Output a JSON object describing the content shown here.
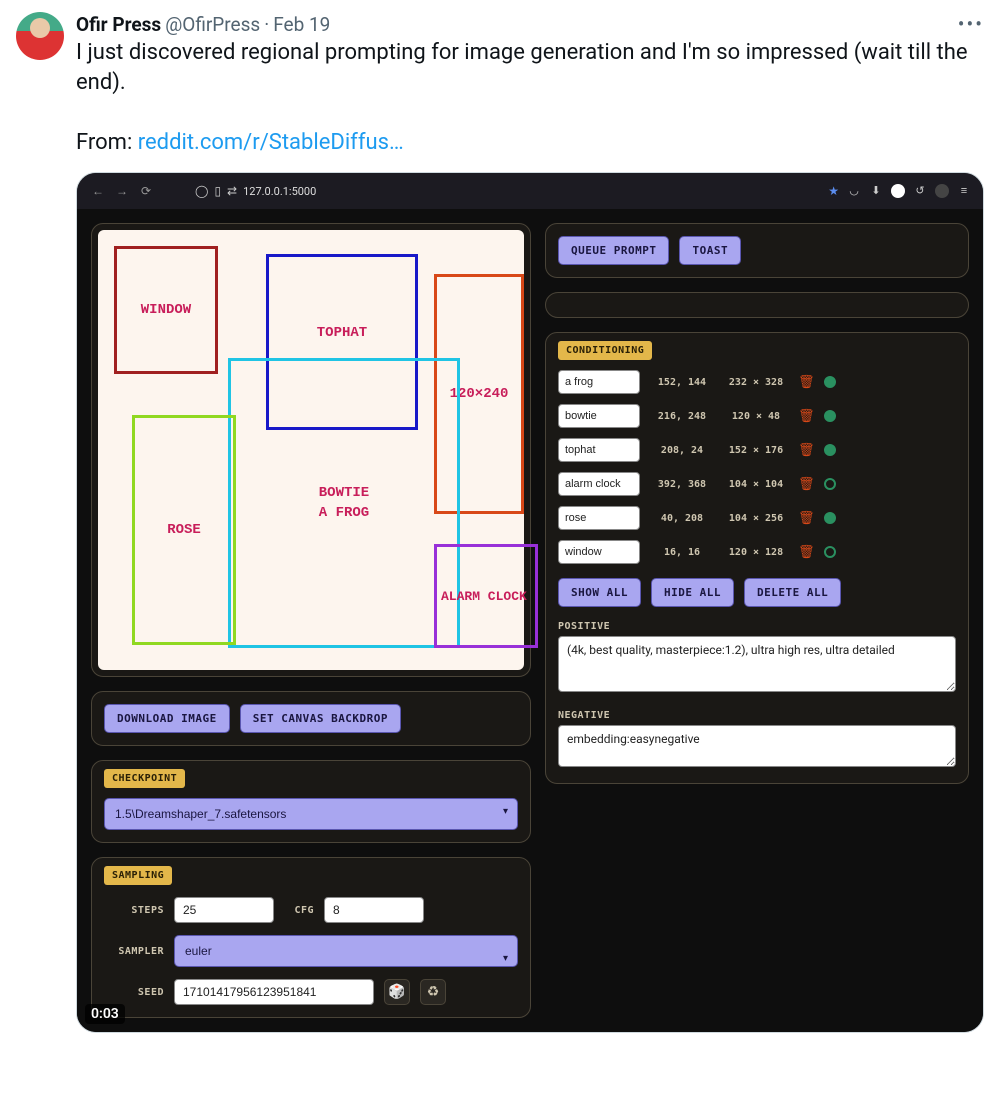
{
  "tweet": {
    "display_name": "Ofir Press",
    "handle": "@OfirPress",
    "date": "Feb 19",
    "text_line1": "I just discovered regional prompting for image generation and I'm so impressed (wait till the end).",
    "text_line2": "From: ",
    "link_text": "reddit.com/r/StableDiffus…",
    "video_timestamp": "0:03"
  },
  "browser": {
    "url": "127.0.0.1:5000"
  },
  "canvas": {
    "regions": {
      "window": "WINDOW",
      "tophat": "TOPHAT",
      "size_label": "120×240",
      "bowtie": "BOWTIE",
      "a_frog": "A FROG",
      "rose": "ROSE",
      "alarm": "ALARM CLOCK"
    }
  },
  "buttons": {
    "download_image": "DOWNLOAD IMAGE",
    "set_backdrop": "SET CANVAS BACKDROP",
    "queue_prompt": "QUEUE PROMPT",
    "toast": "TOAST",
    "show_all": "SHOW ALL",
    "hide_all": "HIDE ALL",
    "delete_all": "DELETE ALL"
  },
  "checkpoint": {
    "label": "CHECKPOINT",
    "value": "1.5\\Dreamshaper_7.safetensors"
  },
  "sampling": {
    "label": "SAMPLING",
    "steps_label": "STEPS",
    "steps": "25",
    "cfg_label": "CFG",
    "cfg": "8",
    "sampler_label": "SAMPLER",
    "sampler": "euler",
    "seed_label": "SEED",
    "seed": "17101417956123951841"
  },
  "conditioning": {
    "label": "CONDITIONING",
    "rows": [
      {
        "name": "a frog",
        "pos": "152, 144",
        "size": "232 × 328"
      },
      {
        "name": "bowtie",
        "pos": "216, 248",
        "size": "120 × 48"
      },
      {
        "name": "tophat",
        "pos": "208, 24",
        "size": "152 × 176"
      },
      {
        "name": "alarm clock",
        "pos": "392, 368",
        "size": "104 × 104"
      },
      {
        "name": "rose",
        "pos": "40, 208",
        "size": "104 × 256"
      },
      {
        "name": "window",
        "pos": "16, 16",
        "size": "120 × 128"
      }
    ],
    "positive_label": "POSITIVE",
    "positive": "(4k, best quality, masterpiece:1.2), ultra high res, ultra detailed",
    "negative_label": "NEGATIVE",
    "negative": "embedding:easynegative"
  }
}
